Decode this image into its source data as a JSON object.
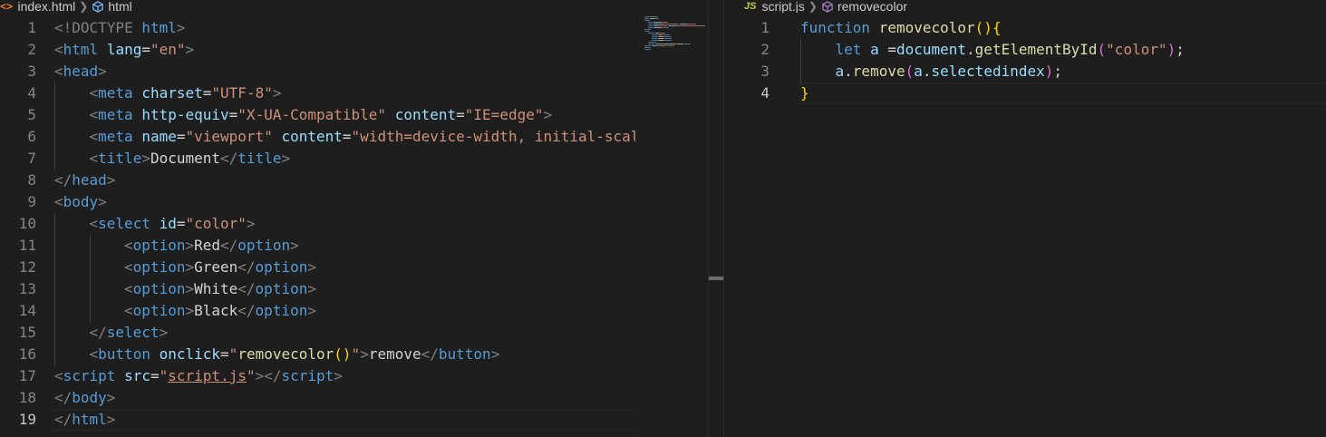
{
  "left_editor": {
    "breadcrumb": {
      "file": "index.html",
      "symbol": "html"
    },
    "lines": [
      {
        "n": "1",
        "indent": 0,
        "tokens": [
          {
            "t": "<!DOCTYPE ",
            "c": "pu"
          },
          {
            "t": "html",
            "c": "tg"
          },
          {
            "t": ">",
            "c": "pu"
          }
        ]
      },
      {
        "n": "2",
        "indent": 0,
        "tokens": [
          {
            "t": "<",
            "c": "pu"
          },
          {
            "t": "html",
            "c": "tg"
          },
          {
            "t": " ",
            "c": "tx"
          },
          {
            "t": "lang",
            "c": "at"
          },
          {
            "t": "=",
            "c": "tx"
          },
          {
            "t": "\"en\"",
            "c": "st"
          },
          {
            "t": ">",
            "c": "pu"
          }
        ]
      },
      {
        "n": "3",
        "indent": 0,
        "tokens": [
          {
            "t": "<",
            "c": "pu"
          },
          {
            "t": "head",
            "c": "tg"
          },
          {
            "t": ">",
            "c": "pu"
          }
        ]
      },
      {
        "n": "4",
        "indent": 1,
        "tokens": [
          {
            "t": "<",
            "c": "pu"
          },
          {
            "t": "meta",
            "c": "tg"
          },
          {
            "t": " ",
            "c": "tx"
          },
          {
            "t": "charset",
            "c": "at"
          },
          {
            "t": "=",
            "c": "tx"
          },
          {
            "t": "\"UTF-8\"",
            "c": "st"
          },
          {
            "t": ">",
            "c": "pu"
          }
        ]
      },
      {
        "n": "5",
        "indent": 1,
        "tokens": [
          {
            "t": "<",
            "c": "pu"
          },
          {
            "t": "meta",
            "c": "tg"
          },
          {
            "t": " ",
            "c": "tx"
          },
          {
            "t": "http-equiv",
            "c": "at"
          },
          {
            "t": "=",
            "c": "tx"
          },
          {
            "t": "\"X-UA-Compatible\"",
            "c": "st"
          },
          {
            "t": " ",
            "c": "tx"
          },
          {
            "t": "content",
            "c": "at"
          },
          {
            "t": "=",
            "c": "tx"
          },
          {
            "t": "\"IE=edge\"",
            "c": "st"
          },
          {
            "t": ">",
            "c": "pu"
          }
        ]
      },
      {
        "n": "6",
        "indent": 1,
        "tokens": [
          {
            "t": "<",
            "c": "pu"
          },
          {
            "t": "meta",
            "c": "tg"
          },
          {
            "t": " ",
            "c": "tx"
          },
          {
            "t": "name",
            "c": "at"
          },
          {
            "t": "=",
            "c": "tx"
          },
          {
            "t": "\"viewport\"",
            "c": "st"
          },
          {
            "t": " ",
            "c": "tx"
          },
          {
            "t": "content",
            "c": "at"
          },
          {
            "t": "=",
            "c": "tx"
          },
          {
            "t": "\"width=device-width, initial-scal",
            "c": "st"
          }
        ]
      },
      {
        "n": "7",
        "indent": 1,
        "tokens": [
          {
            "t": "<",
            "c": "pu"
          },
          {
            "t": "title",
            "c": "tg"
          },
          {
            "t": ">",
            "c": "pu"
          },
          {
            "t": "Document",
            "c": "tx"
          },
          {
            "t": "</",
            "c": "pu"
          },
          {
            "t": "title",
            "c": "tg"
          },
          {
            "t": ">",
            "c": "pu"
          }
        ]
      },
      {
        "n": "8",
        "indent": 0,
        "tokens": [
          {
            "t": "</",
            "c": "pu"
          },
          {
            "t": "head",
            "c": "tg"
          },
          {
            "t": ">",
            "c": "pu"
          }
        ]
      },
      {
        "n": "9",
        "indent": 0,
        "tokens": [
          {
            "t": "<",
            "c": "pu"
          },
          {
            "t": "body",
            "c": "tg"
          },
          {
            "t": ">",
            "c": "pu"
          }
        ]
      },
      {
        "n": "10",
        "indent": 1,
        "tokens": [
          {
            "t": "<",
            "c": "pu"
          },
          {
            "t": "select",
            "c": "tg"
          },
          {
            "t": " ",
            "c": "tx"
          },
          {
            "t": "id",
            "c": "at"
          },
          {
            "t": "=",
            "c": "tx"
          },
          {
            "t": "\"color\"",
            "c": "st"
          },
          {
            "t": ">",
            "c": "pu"
          }
        ]
      },
      {
        "n": "11",
        "indent": 2,
        "tokens": [
          {
            "t": "<",
            "c": "pu"
          },
          {
            "t": "option",
            "c": "tg"
          },
          {
            "t": ">",
            "c": "pu"
          },
          {
            "t": "Red",
            "c": "tx"
          },
          {
            "t": "</",
            "c": "pu"
          },
          {
            "t": "option",
            "c": "tg"
          },
          {
            "t": ">",
            "c": "pu"
          }
        ]
      },
      {
        "n": "12",
        "indent": 2,
        "tokens": [
          {
            "t": "<",
            "c": "pu"
          },
          {
            "t": "option",
            "c": "tg"
          },
          {
            "t": ">",
            "c": "pu"
          },
          {
            "t": "Green",
            "c": "tx"
          },
          {
            "t": "</",
            "c": "pu"
          },
          {
            "t": "option",
            "c": "tg"
          },
          {
            "t": ">",
            "c": "pu"
          }
        ]
      },
      {
        "n": "13",
        "indent": 2,
        "tokens": [
          {
            "t": "<",
            "c": "pu"
          },
          {
            "t": "option",
            "c": "tg"
          },
          {
            "t": ">",
            "c": "pu"
          },
          {
            "t": "White",
            "c": "tx"
          },
          {
            "t": "</",
            "c": "pu"
          },
          {
            "t": "option",
            "c": "tg"
          },
          {
            "t": ">",
            "c": "pu"
          }
        ]
      },
      {
        "n": "14",
        "indent": 2,
        "tokens": [
          {
            "t": "<",
            "c": "pu"
          },
          {
            "t": "option",
            "c": "tg"
          },
          {
            "t": ">",
            "c": "pu"
          },
          {
            "t": "Black",
            "c": "tx"
          },
          {
            "t": "</",
            "c": "pu"
          },
          {
            "t": "option",
            "c": "tg"
          },
          {
            "t": ">",
            "c": "pu"
          }
        ]
      },
      {
        "n": "15",
        "indent": 1,
        "tokens": [
          {
            "t": "</",
            "c": "pu"
          },
          {
            "t": "select",
            "c": "tg"
          },
          {
            "t": ">",
            "c": "pu"
          }
        ]
      },
      {
        "n": "16",
        "indent": 1,
        "tokens": [
          {
            "t": "<",
            "c": "pu"
          },
          {
            "t": "button",
            "c": "tg"
          },
          {
            "t": " ",
            "c": "tx"
          },
          {
            "t": "onclick",
            "c": "at"
          },
          {
            "t": "=",
            "c": "tx"
          },
          {
            "t": "\"",
            "c": "st"
          },
          {
            "t": "removecolor",
            "c": "fn"
          },
          {
            "t": "()",
            "c": "b1"
          },
          {
            "t": "\"",
            "c": "st"
          },
          {
            "t": ">",
            "c": "pu"
          },
          {
            "t": "remove",
            "c": "tx"
          },
          {
            "t": "</",
            "c": "pu"
          },
          {
            "t": "button",
            "c": "tg"
          },
          {
            "t": ">",
            "c": "pu"
          }
        ]
      },
      {
        "n": "17",
        "indent": 0,
        "tokens": [
          {
            "t": "<",
            "c": "pu"
          },
          {
            "t": "script",
            "c": "tg"
          },
          {
            "t": " ",
            "c": "tx"
          },
          {
            "t": "src",
            "c": "at"
          },
          {
            "t": "=",
            "c": "tx"
          },
          {
            "t": "\"",
            "c": "st"
          },
          {
            "t": "script.js",
            "c": "st und"
          },
          {
            "t": "\"",
            "c": "st"
          },
          {
            "t": "></",
            "c": "pu"
          },
          {
            "t": "script",
            "c": "tg"
          },
          {
            "t": ">",
            "c": "pu"
          }
        ]
      },
      {
        "n": "18",
        "indent": 0,
        "tokens": [
          {
            "t": "</",
            "c": "pu"
          },
          {
            "t": "body",
            "c": "tg"
          },
          {
            "t": ">",
            "c": "pu"
          }
        ]
      },
      {
        "n": "19",
        "indent": 0,
        "active": true,
        "tokens": [
          {
            "t": "</",
            "c": "pu"
          },
          {
            "t": "html",
            "c": "tg"
          },
          {
            "t": ">",
            "c": "pu"
          }
        ]
      }
    ]
  },
  "right_editor": {
    "breadcrumb": {
      "file": "script.js",
      "symbol": "removecolor",
      "file_icon": "JS"
    },
    "lines": [
      {
        "n": "1",
        "indent": 0,
        "tokens": [
          {
            "t": "function",
            "c": "kw"
          },
          {
            "t": " ",
            "c": "tx"
          },
          {
            "t": "removecolor",
            "c": "fn"
          },
          {
            "t": "(){",
            "c": "b1"
          }
        ]
      },
      {
        "n": "2",
        "indent": 1,
        "tokens": [
          {
            "t": "let",
            "c": "kw"
          },
          {
            "t": " ",
            "c": "tx"
          },
          {
            "t": "a",
            "c": "vr"
          },
          {
            "t": " =",
            "c": "tx"
          },
          {
            "t": "document",
            "c": "vr"
          },
          {
            "t": ".",
            "c": "tx"
          },
          {
            "t": "getElementById",
            "c": "fn"
          },
          {
            "t": "(",
            "c": "b2"
          },
          {
            "t": "\"color\"",
            "c": "st"
          },
          {
            "t": ")",
            "c": "b2"
          },
          {
            "t": ";",
            "c": "tx"
          }
        ]
      },
      {
        "n": "3",
        "indent": 1,
        "tokens": [
          {
            "t": "a",
            "c": "vr"
          },
          {
            "t": ".",
            "c": "tx"
          },
          {
            "t": "remove",
            "c": "fn"
          },
          {
            "t": "(",
            "c": "b2"
          },
          {
            "t": "a",
            "c": "vr"
          },
          {
            "t": ".",
            "c": "tx"
          },
          {
            "t": "selectedindex",
            "c": "vr"
          },
          {
            "t": ")",
            "c": "b2"
          },
          {
            "t": ";",
            "c": "tx"
          }
        ]
      },
      {
        "n": "4",
        "indent": 0,
        "active": true,
        "tokens": [
          {
            "t": "}",
            "c": "b1"
          }
        ]
      }
    ]
  }
}
